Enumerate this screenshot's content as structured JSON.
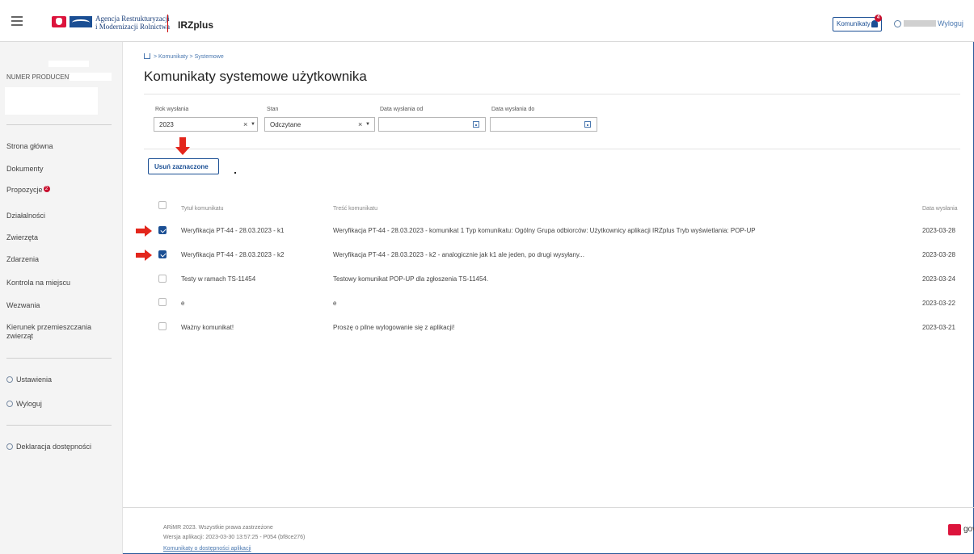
{
  "header": {
    "agency_line1": "Agencja Restrukturyzacji",
    "agency_line2": "i Modernizacji Rolnictwa",
    "app_title": "IRZplus",
    "messages_button": "Komunikaty",
    "messages_badge": "4",
    "logout": "Wyloguj"
  },
  "sidebar": {
    "producer_label": "NUMER PRODUCENTA:",
    "nav": [
      {
        "label": "Strona główna"
      },
      {
        "label": "Dokumenty"
      },
      {
        "label": "Propozycje",
        "badge": "2"
      },
      {
        "label": "Działalności"
      },
      {
        "label": "Zwierzęta"
      },
      {
        "label": "Zdarzenia"
      },
      {
        "label": "Kontrola na miejscu"
      },
      {
        "label": "Wezwania"
      },
      {
        "label": "Kierunek przemieszczania zwierząt"
      }
    ],
    "settings": "Ustawienia",
    "logout": "Wyloguj",
    "accessibility": "Deklaracja dostępności"
  },
  "breadcrumb": {
    "level1": "Komunikaty",
    "level2": "Systemowe",
    "separator": ">"
  },
  "page_title": "Komunikaty systemowe użytkownika",
  "filters": {
    "year_label": "Rok wysłania",
    "year_value": "2023",
    "state_label": "Stan",
    "state_value": "Odczytane",
    "date_from_label": "Data wysłania od",
    "date_to_label": "Data wysłania do"
  },
  "actions": {
    "delete_selected": "Usuń zaznaczone"
  },
  "table": {
    "col_title": "Tytuł komunikatu",
    "col_content": "Treść komunikatu",
    "col_date": "Data wysłania",
    "rows": [
      {
        "checked": true,
        "title": "Weryfikacja PT-44 - 28.03.2023 - k1",
        "content": "Weryfikacja PT-44 - 28.03.2023 - komunikat 1 Typ komunikatu: Ogólny Grupa odbiorców: Użytkownicy aplikacji IRZplus Tryb wyświetlania: POP-UP",
        "date": "2023-03-28"
      },
      {
        "checked": true,
        "title": "Weryfikacja PT-44 - 28.03.2023 - k2",
        "content": "Weryfikacja PT-44 - 28.03.2023 - k2 - analogicznie jak k1 ale jeden, po drugi wysyłany...",
        "date": "2023-03-28"
      },
      {
        "checked": false,
        "title": "Testy w ramach TS-11454",
        "content": "Testowy komunikat POP-UP dla zgłoszenia TS-11454.",
        "date": "2023-03-24"
      },
      {
        "checked": false,
        "title": "e",
        "content": "e",
        "date": "2023-03-22"
      },
      {
        "checked": false,
        "title": "Ważny komunikat!",
        "content": "Proszę o pilne wylogowanie się z aplikacji!",
        "date": "2023-03-21"
      }
    ]
  },
  "footer": {
    "copyright": "ARiMR 2023. Wszystkie prawa zastrzeżone",
    "version": "Wersja aplikacji: 2023-03-30 13:57:25 - P054 (bf8ce276)",
    "accessibility_link": "Komunikaty o dostępności aplikacji",
    "gov": "gov.pl"
  },
  "colors": {
    "primary": "#1b4f94",
    "alert": "#c8102e",
    "annotation_arrow": "#e3261c"
  }
}
